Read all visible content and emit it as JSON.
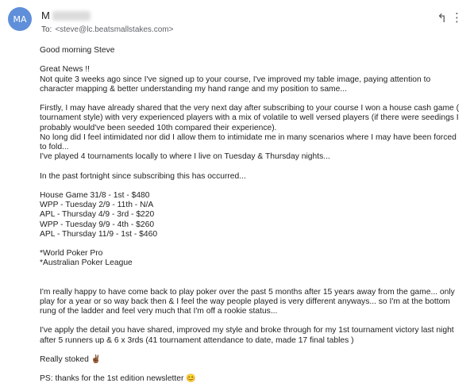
{
  "header": {
    "avatar_initials": "MA",
    "sender_initial": "M",
    "to_label": "To:",
    "to_address": "<steve@lc.beatsmallstakes.com>",
    "reply_icon": "reply-icon",
    "more_icon": "more-vert-icon"
  },
  "email": {
    "greeting": "Good morning Steve",
    "p1_line1": "Great News !!",
    "p1_line2": "Not quite 3 weeks ago since I've signed up to your course, I've improved my table image, paying attention to",
    "p1_line3": "character mapping & better understanding my hand range and my position to same...",
    "p2_line1": "Firstly, I may have already shared that the very next day after subscribing to your course I won a house cash game (",
    "p2_line2": "tournament style) with very experienced players with a mix of volatile to well versed players (if there were seedings I",
    "p2_line3": "probably would've been seeded 10th compared their experience).",
    "p2_line4": "No long did I feel intimidated nor did I allow them to intimidate me in many scenarios where I may have been forced",
    "p2_line5": "to fold...",
    "p2_line6": "I've played 4 tournaments locally to where I live on Tuesday & Thursday nights...",
    "p3": "In the past fortnight since subscribing this has  occurred...",
    "results": [
      "House Game 31/8 - 1st - $480",
      "WPP - Tuesday 2/9 - 11th - N/A",
      "APL - Thursday 4/9 - 3rd - $220",
      "WPP - Tuesday 9/9 - 4th - $260",
      "APL - Thursday 11/9 - 1st - $460"
    ],
    "footnote1": "*World Poker Pro",
    "footnote2": "*Australian Poker League",
    "p4_line1": "I'm really happy to have come back to play poker over the past 5 months after 15 years away from the game... only",
    "p4_line2": "play for a year or so way back then & I feel the way people played is very different anyways... so I'm at the bottom",
    "p4_line3": "rung of the ladder and feel very much that I'm off a rookie status...",
    "p5_line1": "I've apply the detail you have shared, improved my style and broke through for my 1st tournament victory last night",
    "p5_line2": "after 5 runners up & 6 x 3rds (41 tournament attendance to date, made 17 final tables )",
    "stoked": "Really stoked ",
    "stoked_emoji": "✌🏾",
    "ps": "PS: thanks for the 1st edition newsletter ",
    "ps_emoji": "😊"
  }
}
